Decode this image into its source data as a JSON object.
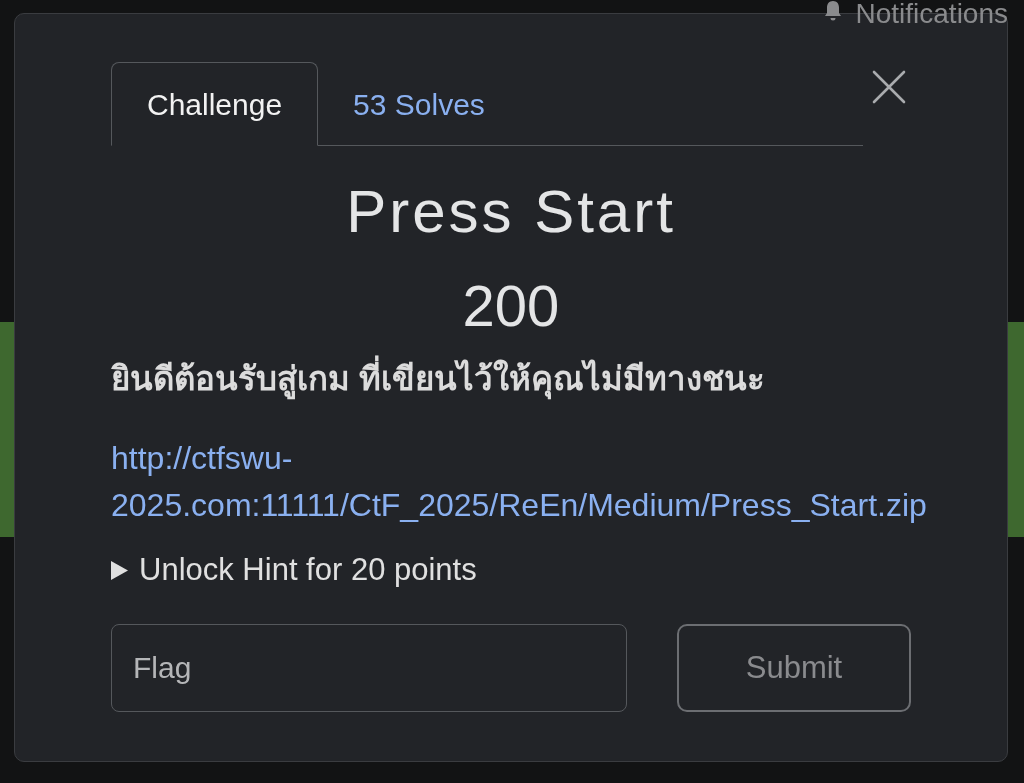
{
  "header": {
    "notifications_label": "Notifications"
  },
  "modal": {
    "tabs": [
      {
        "label": "Challenge",
        "selected": true
      },
      {
        "label": "53 Solves",
        "selected": false
      }
    ],
    "title": "Press Start",
    "points": "200",
    "description": "ยินดีต้อนรับสู่เกม ที่เขียนไว้ให้คุณไม่มีทางชนะ",
    "link": "http://ctfswu-2025.com:11111/CtF_2025/ReEn/Medium/Press_Start.zip",
    "hint": {
      "label": "Unlock Hint for 20 points",
      "expanded": false
    },
    "flag_field": {
      "placeholder": "Flag"
    },
    "submit_button": "Submit"
  }
}
